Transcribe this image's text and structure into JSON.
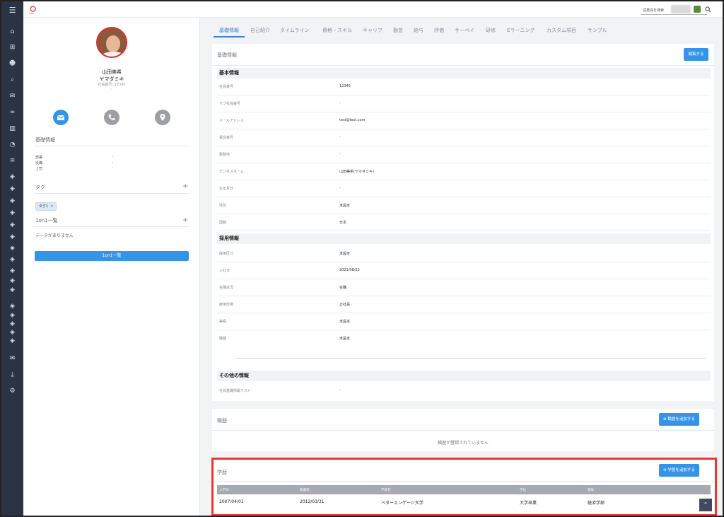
{
  "header": {
    "logo_text": "HRB",
    "search_placeholder": "従業員を検索"
  },
  "profile": {
    "name": "山田美希",
    "kana": "ヤマダミキ",
    "employee_no": "社員番号: 12345",
    "dash": "-",
    "basic_title": "基礎情報",
    "fields": [
      {
        "label": "部署",
        "value": "-"
      },
      {
        "label": "役職",
        "value": "-"
      },
      {
        "label": "上司",
        "value": "-"
      }
    ],
    "tags_title": "タグ",
    "tag": "タグ1",
    "oneonone_title": "1on1一覧",
    "no_data": "データがありません",
    "oneonone_button": "1on1一覧"
  },
  "tabs": [
    "基礎情報",
    "自己紹介",
    "タイムライン",
    "資格・スキル",
    "キャリア",
    "勤怠",
    "給与",
    "評価",
    "サーベイ",
    "研修",
    "Eラーニング",
    "カスタム項目",
    "サンプル"
  ],
  "basic": {
    "title": "基礎情報",
    "edit_button": "編集する",
    "group1": "基本情報",
    "rows1": [
      {
        "label": "社員番号",
        "value": "12345"
      },
      {
        "label": "サブ社員番号",
        "value": "-"
      },
      {
        "label": "メールアドレス",
        "value": "test@test.com"
      },
      {
        "label": "電話番号",
        "value": "-"
      },
      {
        "label": "勤務地",
        "value": "-"
      },
      {
        "label": "ビジネスネーム",
        "value": "山田美希(ヤマダミキ)"
      },
      {
        "label": "生年月日",
        "value": "-"
      },
      {
        "label": "性別",
        "value": "未設定"
      },
      {
        "label": "国籍",
        "value": "日本"
      }
    ],
    "group2": "採用情報",
    "rows2": [
      {
        "label": "採用区分",
        "value": "未設定"
      },
      {
        "label": "入社日",
        "value": "2021/08/22"
      },
      {
        "label": "在職状況",
        "value": "在職"
      },
      {
        "label": "雇用形態",
        "value": "正社員"
      },
      {
        "label": "等級",
        "value": "未設定"
      },
      {
        "label": "職種",
        "value": "未設定"
      }
    ],
    "group3": "その他の情報",
    "rows3": [
      {
        "label": "社員基礎情報テスト",
        "value": "-"
      }
    ]
  },
  "history": {
    "title": "職歴",
    "add_button": "職歴を追加する",
    "empty": "職歴が登録されていません"
  },
  "education": {
    "title": "学歴",
    "add_button": "学歴を追加する",
    "columns": [
      "入学日",
      "卒業日",
      "学校名",
      "学位",
      "専攻"
    ],
    "rows": [
      [
        "2007/04/01",
        "2012/03/31",
        "ベターエンゲージ大学",
        "大学卒業",
        "経済学部"
      ]
    ]
  },
  "colors": {
    "rail": "#2b3345",
    "accent": "#3694e8",
    "highlight": "#e53935"
  }
}
